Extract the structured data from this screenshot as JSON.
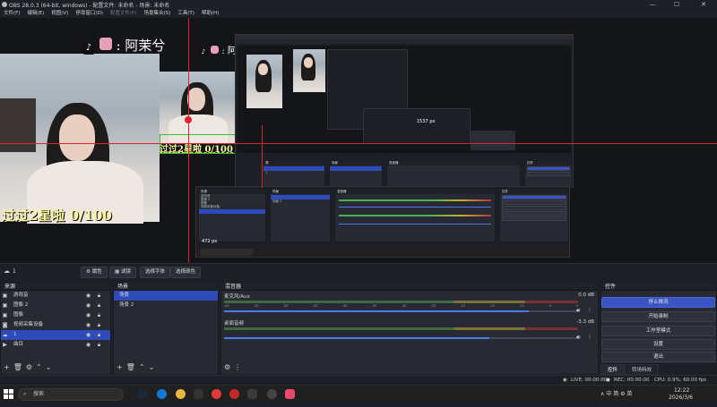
{
  "window": {
    "title": "OBS 28.0.3 (64-bit, windows) - 配置文件: 未命名 - 场景: 未命名",
    "minimize": "—",
    "maximize": "☐",
    "close": "✕"
  },
  "menu": [
    "文件(F)",
    "编辑(E)",
    "视图(V)",
    "停靠窗口(D)",
    "配置文件(P)",
    "场景集合(S)",
    "工具(T)",
    "帮助(H)"
  ],
  "preview": {
    "stream_title": ": 阿茉兮",
    "star_text": "过过2星啦 0/100",
    "measure_1": "472 px",
    "measure_2": "1537 px"
  },
  "source_bar": {
    "source_name": "1",
    "properties": "属性",
    "filters": "滤镜",
    "select_font": "选择字体",
    "select_color": "选择颜色"
  },
  "sources": {
    "title": "来源",
    "items": [
      {
        "name": "游戏音",
        "icon": "image-icon"
      },
      {
        "name": "图像 2",
        "icon": "image-icon"
      },
      {
        "name": "图像",
        "icon": "image-icon"
      },
      {
        "name": "视频采集设备",
        "icon": "camera-icon"
      },
      {
        "name": "1",
        "icon": "text-icon"
      },
      {
        "name": "曲目",
        "icon": "media-icon"
      }
    ]
  },
  "scenes": {
    "title": "场景",
    "items": [
      "场景",
      "场景 2"
    ]
  },
  "mixer": {
    "title": "混音器",
    "tracks": [
      {
        "name": "麦克风/Aux",
        "db": "0.0 dB",
        "level": 0.86
      },
      {
        "name": "桌面音频",
        "db": "-3.3 dB",
        "level": 0.75
      }
    ],
    "scale": [
      "-60",
      "-55",
      "-50",
      "-45",
      "-40",
      "-35",
      "-30",
      "-25",
      "-20",
      "-15",
      "-10",
      "-5",
      "0"
    ]
  },
  "controls": {
    "title": "控件",
    "stop_stream": "停止推流",
    "start_recording": "开始录制",
    "studio_mode": "工作室模式",
    "settings": "设置",
    "exit": "退出"
  },
  "bottom_tabs": {
    "controls": "控件",
    "transitions": "转场特效"
  },
  "status": {
    "live": "LIVE: 00:00:00",
    "rec": "REC: 00:00:00",
    "cpu": "CPU: 0.9%, 60.00 fps"
  },
  "taskbar": {
    "search": "搜索",
    "tray_icons": "∧ 中 简 ⚙ 英",
    "time": "12:22",
    "date": "2026/3/6"
  },
  "colors": {
    "accent": "#2f4bba",
    "live_red": "#e0232e",
    "meter_green": "#4caf50",
    "meter_yellow": "#c4b036",
    "meter_red": "#b33a3a"
  }
}
